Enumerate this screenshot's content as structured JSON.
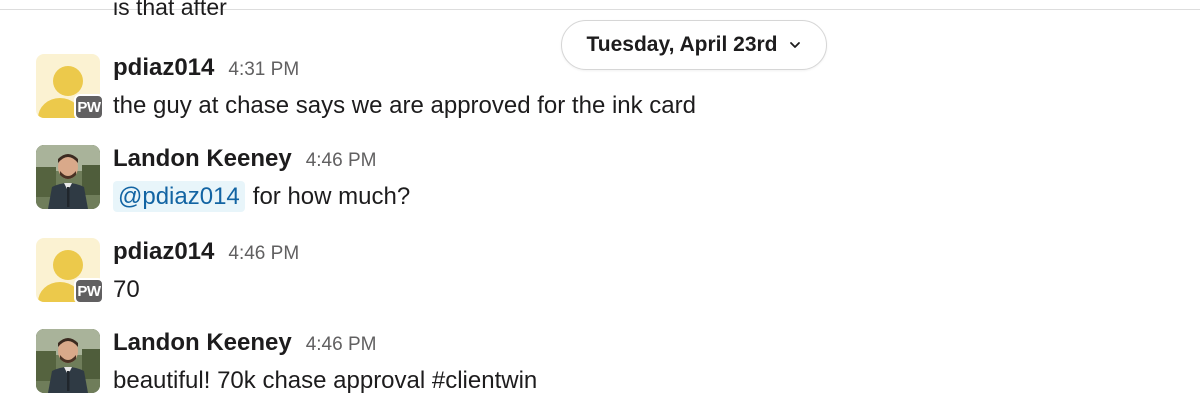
{
  "previous_message": {
    "text": "is that after"
  },
  "date_divider": {
    "label": "Tuesday, April 23rd",
    "icon": "chevron-down-icon"
  },
  "messages": [
    {
      "sender": "pdiaz014",
      "time": "4:31 PM",
      "avatar": {
        "type": "default",
        "badge": "PW"
      },
      "text": "the guy at chase says we are approved for the ink card"
    },
    {
      "sender": "Landon Keeney",
      "time": "4:46 PM",
      "avatar": {
        "type": "photo"
      },
      "mention": "@pdiaz014",
      "text": "for how much?"
    },
    {
      "sender": "pdiaz014",
      "time": "4:46 PM",
      "avatar": {
        "type": "default",
        "badge": "PW"
      },
      "text": "70"
    },
    {
      "sender": "Landon Keeney",
      "time": "4:46 PM",
      "avatar": {
        "type": "photo"
      },
      "text": "beautiful! 70k chase approval #clientwin"
    }
  ],
  "colors": {
    "mention_bg": "#e8f5fa",
    "mention_text": "#1264a3",
    "avatar_yellow": "#ecc94b",
    "badge_bg": "#616061"
  }
}
